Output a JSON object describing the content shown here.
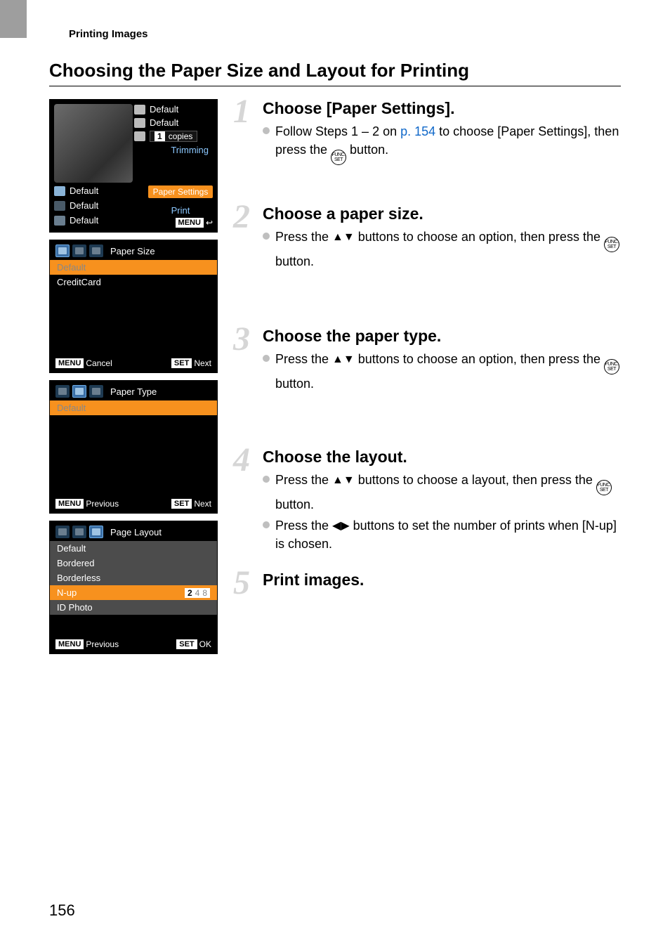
{
  "running_head": "Printing Images",
  "section_title": "Choosing the Paper Size and Layout for Printing",
  "page_number": "156",
  "shot1": {
    "r1": "Default",
    "r2": "Default",
    "copies_num": "1",
    "copies_label": "copies",
    "trimming": "Trimming",
    "b1": "Default",
    "b2": "Default",
    "b3": "Default",
    "paper_settings_btn": "Paper Settings",
    "print_btn": "Print",
    "menu_badge": "MENU"
  },
  "shot2": {
    "tab_label": "Paper Size",
    "opt1": "Default",
    "opt2": "CreditCard",
    "menu_badge": "MENU",
    "menu_label": "Cancel",
    "set_badge": "SET",
    "set_label": "Next"
  },
  "shot3": {
    "tab_label": "Paper Type",
    "opt1": "Default",
    "menu_badge": "MENU",
    "menu_label": "Previous",
    "set_badge": "SET",
    "set_label": "Next"
  },
  "shot4": {
    "tab_label": "Page Layout",
    "opt1": "Default",
    "opt2": "Bordered",
    "opt3": "Borderless",
    "opt4": "N-up",
    "nup_cur": "2",
    "nup_o1": "4",
    "nup_o2": "8",
    "opt5": "ID Photo",
    "menu_badge": "MENU",
    "menu_label": "Previous",
    "set_badge": "SET",
    "set_label": "OK"
  },
  "steps": {
    "s1": {
      "num": "1",
      "head": "Choose [Paper Settings].",
      "b1a": "Follow Steps 1 – 2 on ",
      "b1link": "p. 154",
      "b1b": " to choose [Paper Settings], then press the ",
      "b1c": " button."
    },
    "s2": {
      "num": "2",
      "head": "Choose a paper size.",
      "b1a": "Press the ",
      "b1b": " buttons to choose an option, then press the ",
      "b1c": " button."
    },
    "s3": {
      "num": "3",
      "head": "Choose the paper type.",
      "b1a": "Press the ",
      "b1b": " buttons to choose an option, then press the ",
      "b1c": " button."
    },
    "s4": {
      "num": "4",
      "head": "Choose the layout.",
      "b1a": "Press the ",
      "b1b": " buttons to choose a layout, then press the ",
      "b1c": " button.",
      "b2a": "Press the ",
      "b2b": " buttons to set the number of prints when [N-up] is chosen."
    },
    "s5": {
      "num": "5",
      "head": "Print images."
    }
  },
  "func_top": "FUNC.",
  "func_bot": "SET"
}
